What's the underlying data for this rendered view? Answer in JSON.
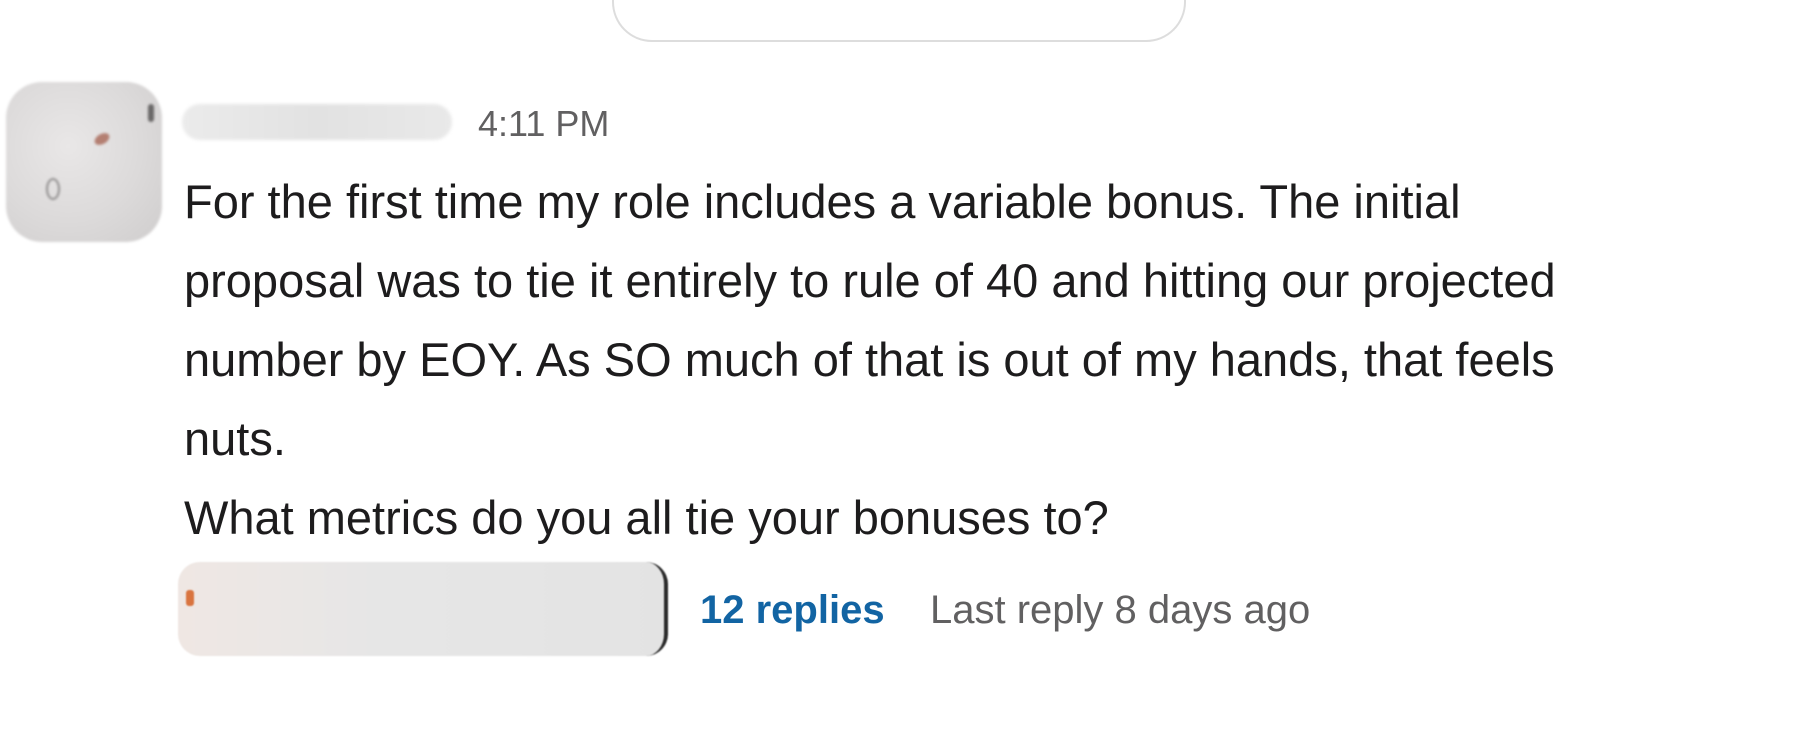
{
  "message": {
    "timestamp": "4:11 PM",
    "lines": [
      "For the first time my role includes a variable bonus. The initial",
      "proposal was to tie it entirely to rule of 40 and hitting our projected",
      "number by EOY. As SO much of that is out of my hands, that feels",
      "nuts.",
      "What metrics do you all tie your bonuses to?"
    ]
  },
  "thread": {
    "replies_label": "12 replies",
    "last_reply_label": "Last reply 8 days ago"
  },
  "colors": {
    "link": "#1264a3",
    "text": "#1d1c1d",
    "muted": "#616061"
  }
}
